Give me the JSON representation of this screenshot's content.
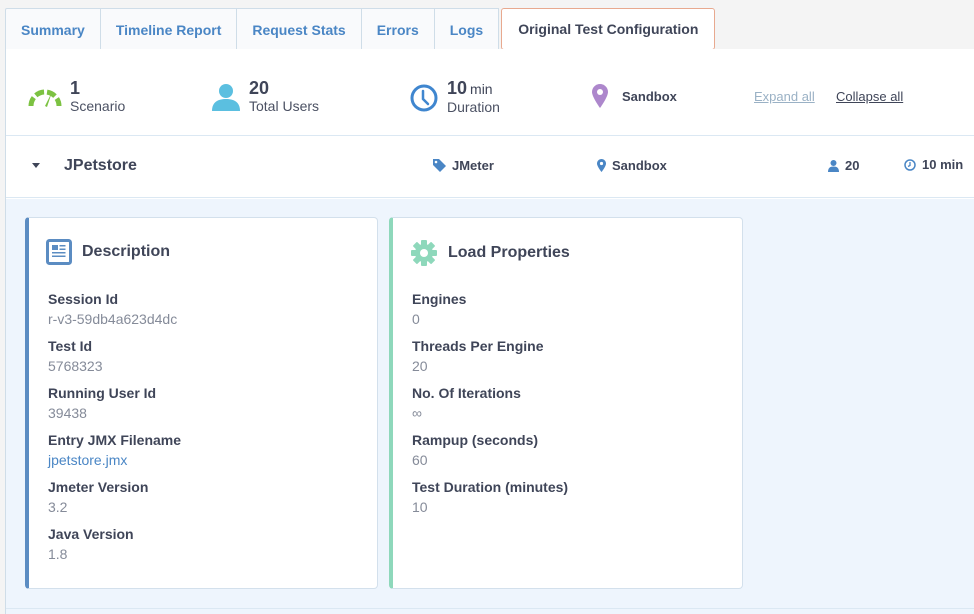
{
  "tabs": [
    {
      "label": "Summary",
      "active": false
    },
    {
      "label": "Timeline Report",
      "active": false
    },
    {
      "label": "Request Stats",
      "active": false
    },
    {
      "label": "Errors",
      "active": false
    },
    {
      "label": "Logs",
      "active": false
    },
    {
      "label": "Original Test Configuration",
      "active": true
    }
  ],
  "summary": {
    "scenarios": {
      "value": "1",
      "label": "Scenario",
      "icon": "speedometer-icon",
      "color": "#7cc242"
    },
    "users": {
      "value": "20",
      "label": "Total Users",
      "icon": "user-icon",
      "color": "#5bbfe0"
    },
    "duration": {
      "value": "10",
      "unit": "min",
      "label": "Duration",
      "icon": "clock-icon",
      "color": "#3f86cf"
    },
    "location": {
      "label": "Sandbox",
      "icon": "map-pin-icon",
      "color": "#ad87cc"
    },
    "expand_all": "Expand all",
    "collapse_all": "Collapse all"
  },
  "scenario": {
    "name": "JPetstore",
    "type": "JMeter",
    "location": "Sandbox",
    "users": "20",
    "duration": "10 min",
    "icon_color": "#4a86c5"
  },
  "description": {
    "title": "Description",
    "fields": [
      {
        "label": "Session Id",
        "value": "r-v3-59db4a623d4dc"
      },
      {
        "label": "Test Id",
        "value": "5768323"
      },
      {
        "label": "Running User Id",
        "value": "39438"
      },
      {
        "label": "Entry JMX Filename",
        "value": "jpetstore.jmx"
      },
      {
        "label": "Jmeter Version",
        "value": "3.2"
      },
      {
        "label": "Java Version",
        "value": "1.8"
      }
    ]
  },
  "load_properties": {
    "title": "Load Properties",
    "fields": [
      {
        "label": "Engines",
        "value": "0"
      },
      {
        "label": "Threads Per Engine",
        "value": "20"
      },
      {
        "label": "No. Of Iterations",
        "value": "∞"
      },
      {
        "label": "Rampup (seconds)",
        "value": "60"
      },
      {
        "label": "Test Duration (minutes)",
        "value": "10"
      }
    ]
  }
}
